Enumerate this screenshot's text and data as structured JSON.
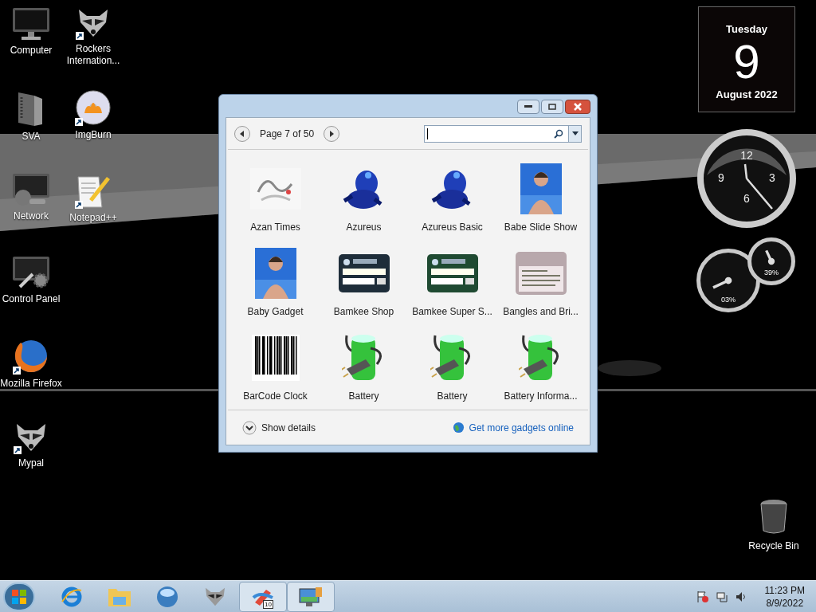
{
  "desktop_icons": {
    "column_1": [
      {
        "label": "Computer",
        "kind": "monitor",
        "shortcut": false
      },
      {
        "label": "SVA",
        "kind": "folder",
        "shortcut": false
      },
      {
        "label": "Network",
        "kind": "network",
        "shortcut": false
      },
      {
        "label": "Control Panel",
        "kind": "control",
        "shortcut": false
      },
      {
        "label": "Mozilla Firefox",
        "kind": "firefox",
        "shortcut": true
      },
      {
        "label": "Mypal",
        "kind": "raccoon",
        "shortcut": true
      }
    ],
    "column_2": [
      {
        "label": "Rockers Internation...",
        "kind": "raccoon",
        "shortcut": true
      },
      {
        "label": "ImgBurn",
        "kind": "disc",
        "shortcut": true
      },
      {
        "label": "Notepad++",
        "kind": "notepad",
        "shortcut": true
      }
    ]
  },
  "recycle_bin": {
    "label": "Recycle Bin"
  },
  "gadget_window": {
    "page_label": "Page 7 of 50",
    "gadgets": [
      {
        "name": "Azan Times",
        "kind": "logo"
      },
      {
        "name": "Azureus",
        "kind": "frog"
      },
      {
        "name": "Azureus Basic",
        "kind": "frog"
      },
      {
        "name": "Babe Slide Show"
      },
      {
        "name": "Baby Gadget"
      },
      {
        "name": "Bamkee Shop",
        "kind": "widget",
        "color": "#1e2d3a"
      },
      {
        "name": "Bamkee Super S...",
        "kind": "widget",
        "color": "#1f4a32"
      },
      {
        "name": "Bangles and Bri...",
        "kind": "note"
      },
      {
        "name": "BarCode Clock",
        "kind": "barcode"
      },
      {
        "name": "Battery",
        "kind": "battery"
      },
      {
        "name": "Battery",
        "kind": "battery"
      },
      {
        "name": "Battery Informa...",
        "kind": "battery"
      }
    ],
    "details_label": "Show details",
    "online_link": "Get more gadgets online"
  },
  "calendar": {
    "weekday": "Tuesday",
    "day": "9",
    "month": "August 2022"
  },
  "clock": {
    "numerals": [
      "12",
      "3",
      "6",
      "9"
    ]
  },
  "meters": [
    {
      "reading": "03%"
    },
    {
      "reading": "39%"
    }
  ],
  "taskbar": {
    "items": [
      {
        "kind": "ie",
        "active": false
      },
      {
        "kind": "explorer",
        "active": false
      },
      {
        "kind": "media",
        "active": false
      },
      {
        "kind": "raccoon",
        "active": false
      },
      {
        "kind": "pen",
        "active": true,
        "badge": "10"
      },
      {
        "kind": "gadgets",
        "active": true
      }
    ],
    "time": "11:23 PM",
    "date": "8/9/2022"
  }
}
